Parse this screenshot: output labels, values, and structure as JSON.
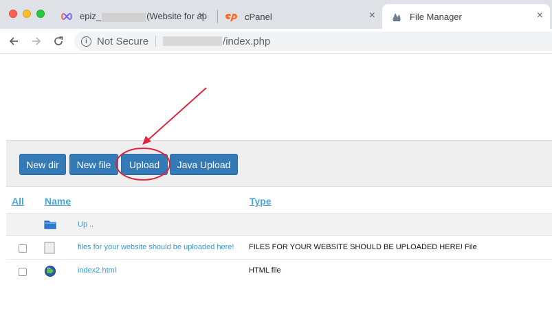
{
  "browser": {
    "tabs": [
      {
        "title_prefix": "epiz_",
        "title_suffix": "(Website for ap",
        "favicon": "infinity-icon"
      },
      {
        "title": "cPanel",
        "favicon": "cpanel-icon"
      },
      {
        "title": "File Manager",
        "favicon": "file-manager-icon",
        "active": true
      }
    ],
    "address_bar": {
      "security": "Not Secure",
      "url_path": "/index.php"
    }
  },
  "toolbar": {
    "buttons": [
      "New dir",
      "New file",
      "Upload",
      "Java Upload"
    ]
  },
  "table": {
    "headers": {
      "all": "All",
      "name": "Name",
      "type": "Type"
    },
    "up_row": {
      "name": "Up ..",
      "icon": "folder-icon"
    },
    "rows": [
      {
        "name": "files for your website should be uploaded here!",
        "type": "FILES FOR YOUR WEBSITE SHOULD BE UPLOADED HERE! File",
        "icon": "file-icon"
      },
      {
        "name": "index2.html",
        "type": "HTML file",
        "icon": "globe-icon"
      }
    ]
  },
  "colors": {
    "button_bg": "#337ab7",
    "link": "#4aa6d6",
    "annotation": "#e0223c"
  }
}
